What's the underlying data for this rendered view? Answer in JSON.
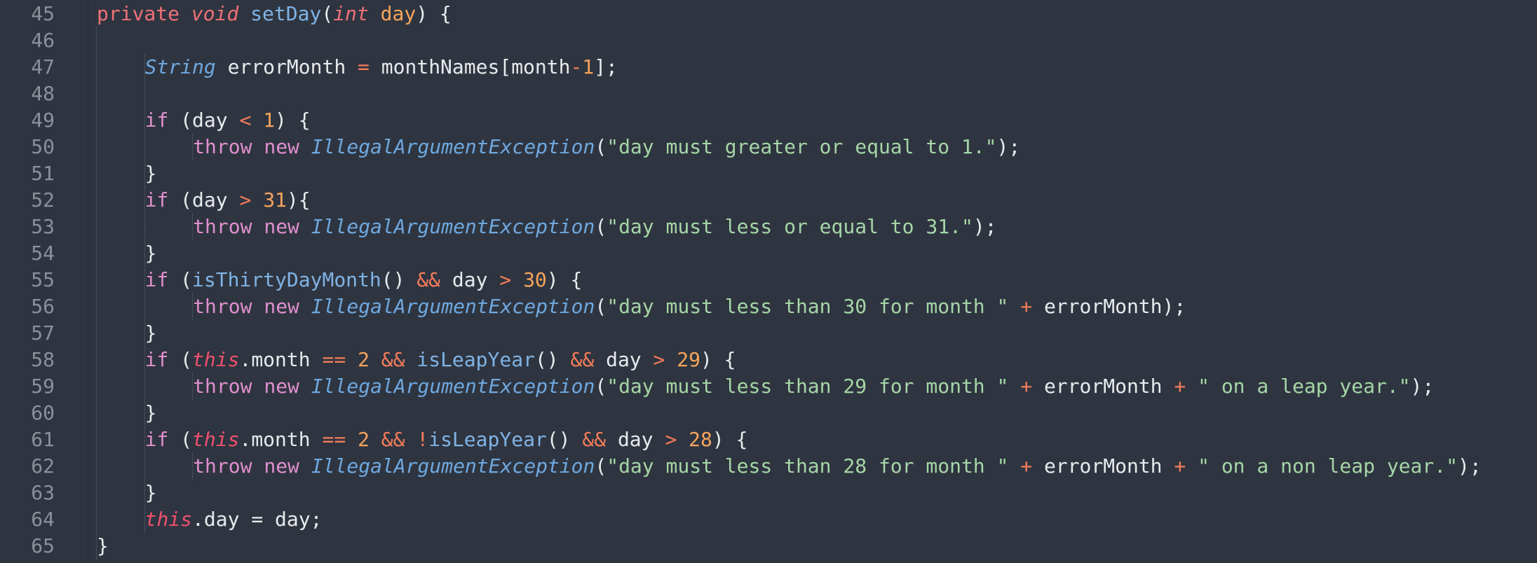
{
  "editor": {
    "background": "#2f3540",
    "first_line": 45,
    "lines": [
      {
        "n": "45",
        "indent": 1,
        "tokens": [
          [
            "kw",
            "private"
          ],
          [
            "p",
            " "
          ],
          [
            "type",
            "void"
          ],
          [
            "p",
            " "
          ],
          [
            "fn",
            "setDay"
          ],
          [
            "p",
            "("
          ],
          [
            "type",
            "int"
          ],
          [
            "p",
            " "
          ],
          [
            "param",
            "day"
          ],
          [
            "p",
            ") {"
          ]
        ]
      },
      {
        "n": "46",
        "indent": 0,
        "tokens": []
      },
      {
        "n": "47",
        "indent": 2,
        "tokens": [
          [
            "class",
            "String"
          ],
          [
            "p",
            " errorMonth "
          ],
          [
            "op",
            "="
          ],
          [
            "p",
            " monthNames[month"
          ],
          [
            "op",
            "-"
          ],
          [
            "num",
            "1"
          ],
          [
            "p",
            "];"
          ]
        ]
      },
      {
        "n": "48",
        "indent": 0,
        "tokens": []
      },
      {
        "n": "49",
        "indent": 2,
        "tokens": [
          [
            "ctrl",
            "if"
          ],
          [
            "p",
            " (day "
          ],
          [
            "op",
            "<"
          ],
          [
            "p",
            " "
          ],
          [
            "num",
            "1"
          ],
          [
            "p",
            ") {"
          ]
        ]
      },
      {
        "n": "50",
        "indent": 3,
        "tokens": [
          [
            "ctrl",
            "throw"
          ],
          [
            "p",
            " "
          ],
          [
            "ctrl",
            "new"
          ],
          [
            "p",
            " "
          ],
          [
            "class",
            "IllegalArgumentException"
          ],
          [
            "p",
            "("
          ],
          [
            "str",
            "\"day must greater or equal to 1.\""
          ],
          [
            "p",
            ");"
          ]
        ]
      },
      {
        "n": "51",
        "indent": 2,
        "tokens": [
          [
            "p",
            "}"
          ]
        ]
      },
      {
        "n": "52",
        "indent": 2,
        "tokens": [
          [
            "ctrl",
            "if"
          ],
          [
            "p",
            " (day "
          ],
          [
            "op",
            ">"
          ],
          [
            "p",
            " "
          ],
          [
            "num",
            "31"
          ],
          [
            "p",
            "){"
          ]
        ]
      },
      {
        "n": "53",
        "indent": 3,
        "tokens": [
          [
            "ctrl",
            "throw"
          ],
          [
            "p",
            " "
          ],
          [
            "ctrl",
            "new"
          ],
          [
            "p",
            " "
          ],
          [
            "class",
            "IllegalArgumentException"
          ],
          [
            "p",
            "("
          ],
          [
            "str",
            "\"day must less or equal to 31.\""
          ],
          [
            "p",
            ");"
          ]
        ]
      },
      {
        "n": "54",
        "indent": 2,
        "tokens": [
          [
            "p",
            "}"
          ]
        ]
      },
      {
        "n": "55",
        "indent": 2,
        "tokens": [
          [
            "ctrl",
            "if"
          ],
          [
            "p",
            " ("
          ],
          [
            "fn",
            "isThirtyDayMonth"
          ],
          [
            "p",
            "() "
          ],
          [
            "op",
            "&&"
          ],
          [
            "p",
            " day "
          ],
          [
            "op",
            ">"
          ],
          [
            "p",
            " "
          ],
          [
            "num",
            "30"
          ],
          [
            "p",
            ") {"
          ]
        ]
      },
      {
        "n": "56",
        "indent": 3,
        "tokens": [
          [
            "ctrl",
            "throw"
          ],
          [
            "p",
            " "
          ],
          [
            "ctrl",
            "new"
          ],
          [
            "p",
            " "
          ],
          [
            "class",
            "IllegalArgumentException"
          ],
          [
            "p",
            "("
          ],
          [
            "str",
            "\"day must less than 30 for month \""
          ],
          [
            "p",
            " "
          ],
          [
            "op",
            "+"
          ],
          [
            "p",
            " errorMonth);"
          ]
        ]
      },
      {
        "n": "57",
        "indent": 2,
        "tokens": [
          [
            "p",
            "}"
          ]
        ]
      },
      {
        "n": "58",
        "indent": 2,
        "tokens": [
          [
            "ctrl",
            "if"
          ],
          [
            "p",
            " ("
          ],
          [
            "this",
            "this"
          ],
          [
            "p",
            ".month "
          ],
          [
            "op",
            "=="
          ],
          [
            "p",
            " "
          ],
          [
            "num",
            "2"
          ],
          [
            "p",
            " "
          ],
          [
            "op",
            "&&"
          ],
          [
            "p",
            " "
          ],
          [
            "fn",
            "isLeapYear"
          ],
          [
            "p",
            "() "
          ],
          [
            "op",
            "&&"
          ],
          [
            "p",
            " day "
          ],
          [
            "op",
            ">"
          ],
          [
            "p",
            " "
          ],
          [
            "num",
            "29"
          ],
          [
            "p",
            ") {"
          ]
        ]
      },
      {
        "n": "59",
        "indent": 3,
        "tokens": [
          [
            "ctrl",
            "throw"
          ],
          [
            "p",
            " "
          ],
          [
            "ctrl",
            "new"
          ],
          [
            "p",
            " "
          ],
          [
            "class",
            "IllegalArgumentException"
          ],
          [
            "p",
            "("
          ],
          [
            "str",
            "\"day must less than 29 for month \""
          ],
          [
            "p",
            " "
          ],
          [
            "op",
            "+"
          ],
          [
            "p",
            " errorMonth "
          ],
          [
            "op",
            "+"
          ],
          [
            "p",
            " "
          ],
          [
            "str",
            "\" on a leap year.\""
          ],
          [
            "p",
            ");"
          ]
        ]
      },
      {
        "n": "60",
        "indent": 2,
        "tokens": [
          [
            "p",
            "}"
          ]
        ]
      },
      {
        "n": "61",
        "indent": 2,
        "tokens": [
          [
            "ctrl",
            "if"
          ],
          [
            "p",
            " ("
          ],
          [
            "this",
            "this"
          ],
          [
            "p",
            ".month "
          ],
          [
            "op",
            "=="
          ],
          [
            "p",
            " "
          ],
          [
            "num",
            "2"
          ],
          [
            "p",
            " "
          ],
          [
            "op",
            "&&"
          ],
          [
            "p",
            " "
          ],
          [
            "op",
            "!"
          ],
          [
            "fn",
            "isLeapYear"
          ],
          [
            "p",
            "() "
          ],
          [
            "op",
            "&&"
          ],
          [
            "p",
            " day "
          ],
          [
            "op",
            ">"
          ],
          [
            "p",
            " "
          ],
          [
            "num",
            "28"
          ],
          [
            "p",
            ") {"
          ]
        ]
      },
      {
        "n": "62",
        "indent": 3,
        "tokens": [
          [
            "ctrl",
            "throw"
          ],
          [
            "p",
            " "
          ],
          [
            "ctrl",
            "new"
          ],
          [
            "p",
            " "
          ],
          [
            "class",
            "IllegalArgumentException"
          ],
          [
            "p",
            "("
          ],
          [
            "str",
            "\"day must less than 28 for month \""
          ],
          [
            "p",
            " "
          ],
          [
            "op",
            "+"
          ],
          [
            "p",
            " errorMonth "
          ],
          [
            "op",
            "+"
          ],
          [
            "p",
            " "
          ],
          [
            "str",
            "\" on a non leap year.\""
          ],
          [
            "p",
            ");"
          ]
        ]
      },
      {
        "n": "63",
        "indent": 2,
        "tokens": [
          [
            "p",
            "}"
          ]
        ]
      },
      {
        "n": "64",
        "indent": 2,
        "tokens": [
          [
            "this",
            "this"
          ],
          [
            "p",
            ".day = day;"
          ]
        ]
      },
      {
        "n": "65",
        "indent": 1,
        "tokens": [
          [
            "p",
            "}"
          ]
        ]
      }
    ]
  },
  "colors": {
    "keyword": "#f07178",
    "control": "#e08fd0",
    "class": "#6ea8e0",
    "function": "#7fb3e6",
    "number": "#f5a45d",
    "operator": "#f57c5a",
    "string": "#a5d6a7",
    "this": "#f0506e",
    "plain": "#e8eaed",
    "line_number": "#8b919b"
  }
}
